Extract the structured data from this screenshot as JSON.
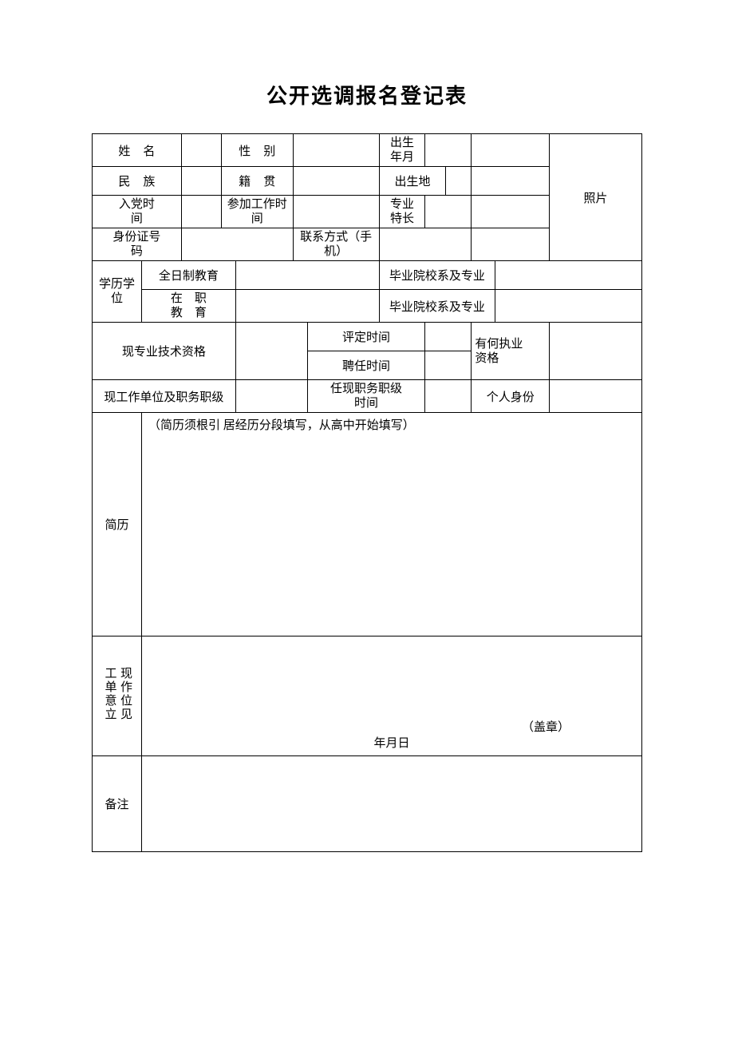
{
  "title": "公开选调报名登记表",
  "labels": {
    "name": "姓名",
    "gender": "性别",
    "birth": "出生\n年月",
    "ethnicity": "民族",
    "native_place": "籍贯",
    "birthplace": "出生地",
    "photo": "照片",
    "party_join": "入党时\n间",
    "work_start": "参加工作时\n间",
    "specialty": "专业\n特长",
    "id_number": "身份证号\n码",
    "contact": "联系方式（手\n机）",
    "edu_degree": "学历学\n位",
    "fulltime_edu": "全日制教育",
    "inservice_edu_l1": "在　职",
    "inservice_edu_l2": "教　育",
    "grad_school": "毕业院校系及专业",
    "tech_title": "现专业技术资格",
    "assess_time": "评定时间",
    "appoint_time": "聘任时间",
    "practice_qual": "有何执业\n资格",
    "current_unit": "现工作单位及职务职级",
    "position_time": "任现职务职级\n时间",
    "personal_identity": "个人身份",
    "resume": "简历",
    "resume_hint": "（简历须根引 居经历分段填写，从高中开始填写）",
    "opinion_l1": "工单意立",
    "opinion_l2": "现作位见",
    "stamp": "（盖章）",
    "date": "年月日",
    "remark": "备注"
  }
}
